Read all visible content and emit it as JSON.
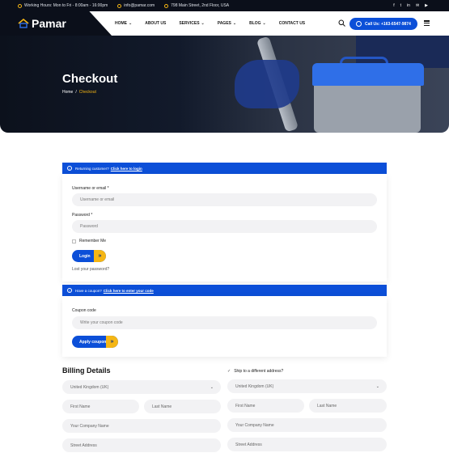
{
  "topbar": {
    "hours": "Working Hours: Mon to Fri - 8:00am - 16:00pm",
    "email": "info@pamar.com",
    "address": "798 Main Street, 2nd Floor, USA",
    "social": [
      "f",
      "t",
      "in",
      "✉",
      "▶"
    ]
  },
  "header": {
    "logo": "Pamar",
    "nav": [
      {
        "label": "HOME",
        "dropdown": true
      },
      {
        "label": "ABOUT US",
        "dropdown": false
      },
      {
        "label": "SERVICES",
        "dropdown": true
      },
      {
        "label": "PAGES",
        "dropdown": true
      },
      {
        "label": "BLOG",
        "dropdown": true
      },
      {
        "label": "CONTACT US",
        "dropdown": false
      }
    ],
    "call_label": "Call Us: +163-6547-9874"
  },
  "hero": {
    "title": "Checkout",
    "breadcrumb_home": "Home",
    "breadcrumb_sep": "/",
    "breadcrumb_current": "Checkout"
  },
  "login_notice": {
    "text": "Returning customer?",
    "link": "Click here to login"
  },
  "login_form": {
    "username_label": "Username or email *",
    "username_placeholder": "Username or email",
    "password_label": "Password *",
    "password_placeholder": "Password",
    "remember_label": "Remember Me",
    "login_button": "Login",
    "lost_password": "Lost your password?"
  },
  "coupon_notice": {
    "text": "Have a coupon?",
    "link": "Click here to enter your code"
  },
  "coupon_form": {
    "label": "Coupon code",
    "placeholder": "Write your coupon code",
    "button": "Apply coupon"
  },
  "billing": {
    "title": "Billing Details",
    "country": "United Kingdom (UK)",
    "first_name": "First Name",
    "last_name": "Last Name",
    "company": "Your Company Name",
    "street": "Street Address"
  },
  "shipping": {
    "checkbox_label": "Ship to a different address?",
    "country": "United Kingdom (UK)",
    "first_name": "First Name",
    "last_name": "Last Name",
    "company": "Your Company Name",
    "street": "Street Address"
  },
  "colors": {
    "primary": "#0c4fd8",
    "accent": "#f5b614",
    "dark": "#0b0f1a"
  }
}
